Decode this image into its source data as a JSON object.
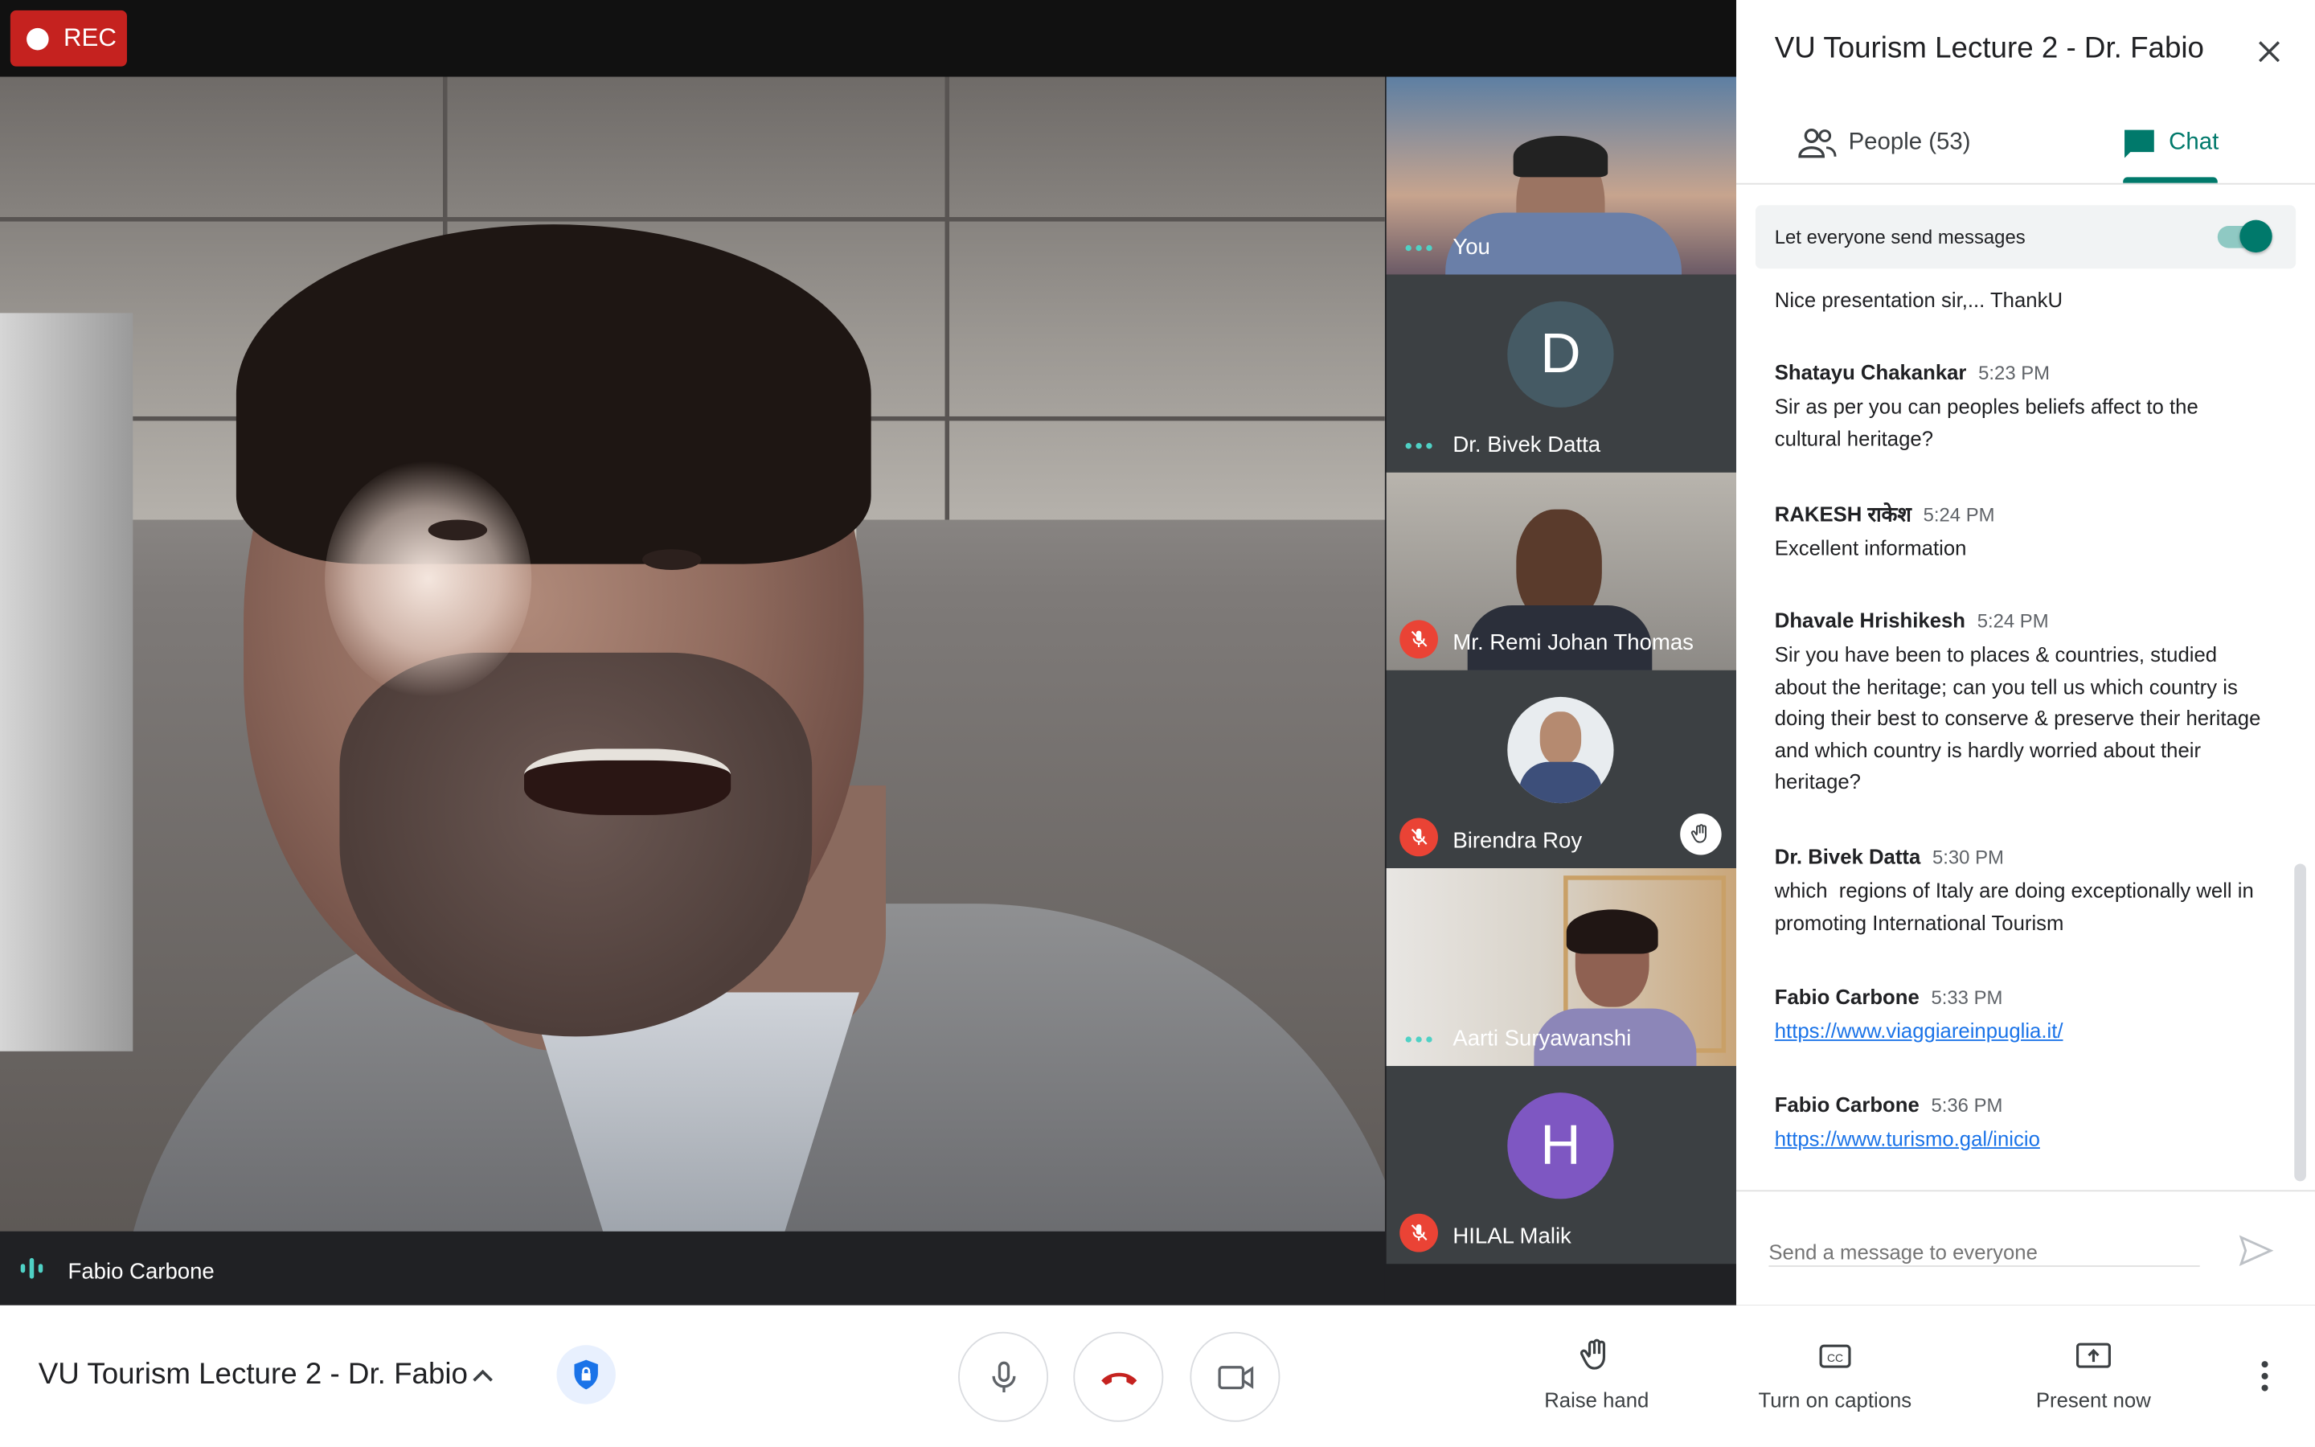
{
  "recording": {
    "label": "REC"
  },
  "main_video": {
    "speaker_name": "Fabio Carbone"
  },
  "tiles": [
    {
      "name": "You",
      "status": "speaking"
    },
    {
      "name": "Dr. Bivek Datta",
      "initial": "D",
      "avatar_color": "#455a64",
      "status": "speaking"
    },
    {
      "name": "Mr. Remi Johan Thomas",
      "status": "muted"
    },
    {
      "name": "Birendra Roy",
      "status": "muted",
      "hand_raised": true
    },
    {
      "name": "Aarti Suryawanshi",
      "status": "speaking"
    },
    {
      "name": "HILAL Malik",
      "initial": "H",
      "avatar_color": "#7e57c2",
      "status": "muted"
    }
  ],
  "panel": {
    "title": "VU Tourism Lecture 2 - Dr. Fabio",
    "tabs": {
      "people": "People (53)",
      "chat": "Chat"
    },
    "toggle_label": "Let everyone send messages",
    "toggle_on": true,
    "messages": [
      {
        "text": "Nice presentation sir,... ThankU"
      },
      {
        "sender": "Shatayu Chakankar",
        "time": "5:23 PM",
        "text": "Sir as per you can peoples beliefs affect to the cultural heritage?"
      },
      {
        "sender": "RAKESH राकेश",
        "time": "5:24 PM",
        "text": "Excellent information"
      },
      {
        "sender": "Dhavale Hrishikesh",
        "time": "5:24 PM",
        "text": "Sir you have been to places & countries, studied about the heritage; can you tell us which country is doing their best to conserve & preserve their heritage and which country is hardly worried about their heritage?"
      },
      {
        "sender": "Dr. Bivek Datta",
        "time": "5:30 PM",
        "text": "which  regions of Italy are doing exceptionally well in promoting International Tourism"
      },
      {
        "sender": "Fabio Carbone",
        "time": "5:33 PM",
        "link": "https://www.viaggiareinpuglia.it/"
      },
      {
        "sender": "Fabio Carbone",
        "time": "5:36 PM",
        "link": "https://www.turismo.gal/inicio"
      }
    ],
    "input_placeholder": "Send a message to everyone"
  },
  "bottom": {
    "meeting_title": "VU Tourism Lecture 2 - Dr. Fabio",
    "raise_hand": "Raise hand",
    "captions": "Turn on captions",
    "present": "Present now"
  },
  "colors": {
    "accent": "#00796b",
    "rec": "#c5221f",
    "hangup": "#c5221f",
    "link": "#1a73e8",
    "mute": "#ea4335"
  }
}
